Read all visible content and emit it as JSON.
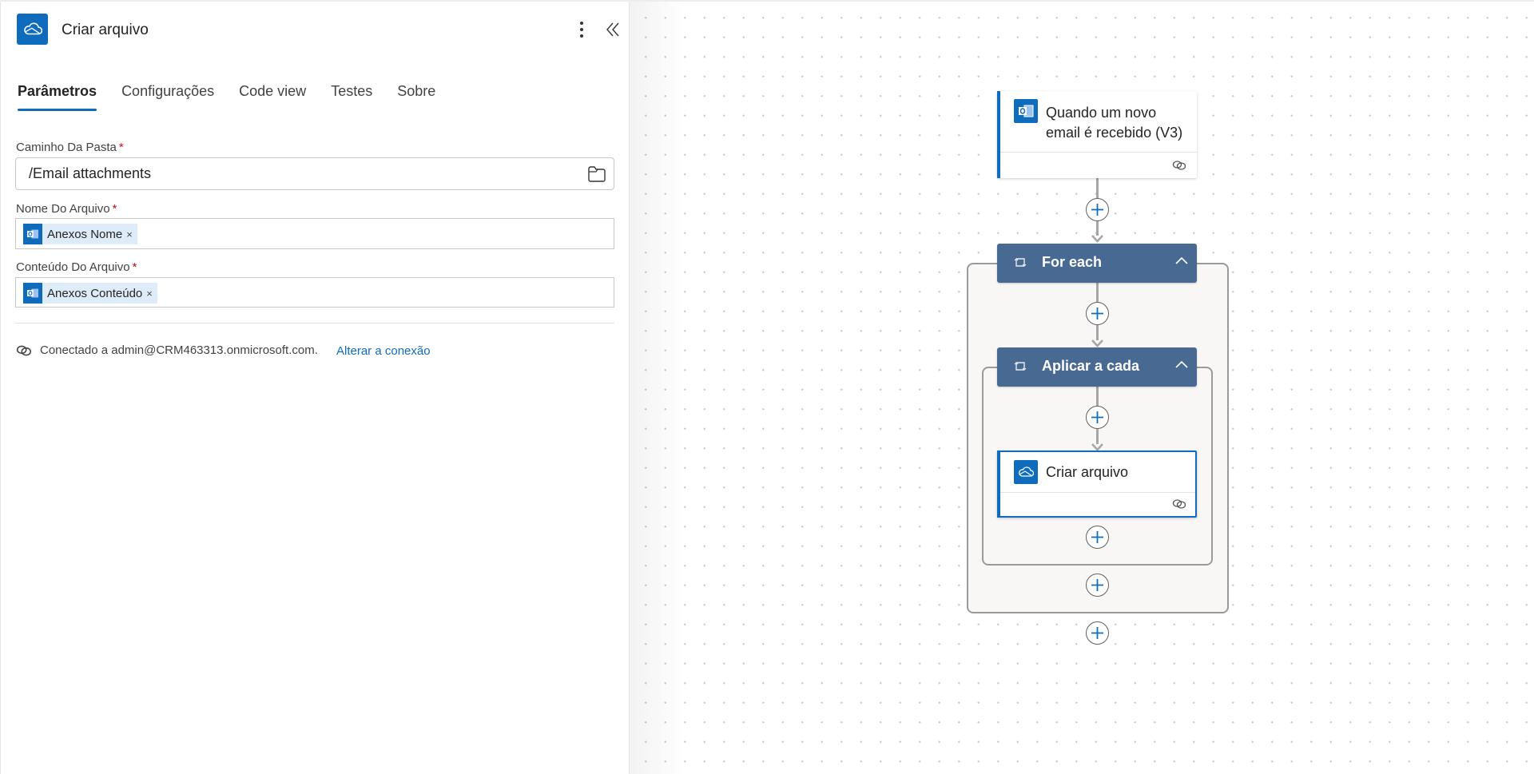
{
  "panel": {
    "title": "Criar arquivo",
    "icon": "onedrive-cloud-icon",
    "more_icon": "more-vertical-icon",
    "collapse_icon": "double-chevron-left-icon",
    "tabs": [
      {
        "label": "Parâmetros",
        "active": true
      },
      {
        "label": "Configurações",
        "active": false
      },
      {
        "label": "Code view",
        "active": false
      },
      {
        "label": "Testes",
        "active": false
      },
      {
        "label": "Sobre",
        "active": false
      }
    ],
    "fields": {
      "folder_path": {
        "label": "Caminho Da Pasta",
        "required_mark": "*",
        "value": "/Email attachments",
        "icon": "folder-icon"
      },
      "file_name": {
        "label": "Nome Do Arquivo",
        "required_mark": "*",
        "token": "Anexos Nome",
        "token_remove": "×",
        "token_icon": "outlook-icon"
      },
      "file_content": {
        "label": "Conteúdo Do Arquivo",
        "required_mark": "*",
        "token": "Anexos Conteúdo",
        "token_remove": "×",
        "token_icon": "outlook-icon"
      }
    },
    "connection": {
      "icon": "connection-link-icon",
      "text": "Conectado a admin@CRM463313.onmicrosoft.com.",
      "change_link": "Alterar a conexão"
    }
  },
  "flow": {
    "trigger": {
      "title": "Quando um novo email é recebido (V3)",
      "icon": "outlook-icon",
      "footer_icon": "connection-link-icon"
    },
    "for_each": {
      "title": "For each",
      "icon": "loop-icon",
      "chevron": "chevron-up-icon"
    },
    "apply_each": {
      "title": "Aplicar a cada",
      "icon": "loop-icon",
      "chevron": "chevron-up-icon"
    },
    "create_file": {
      "title": "Criar arquivo",
      "icon": "onedrive-cloud-icon",
      "footer_icon": "connection-link-icon",
      "selected": true
    },
    "add_step_icon": "plus-icon"
  },
  "colors": {
    "accent": "#0f6cbd",
    "loop_header": "#486991",
    "required": "#c50f1f",
    "token_bg": "#deecf9"
  }
}
